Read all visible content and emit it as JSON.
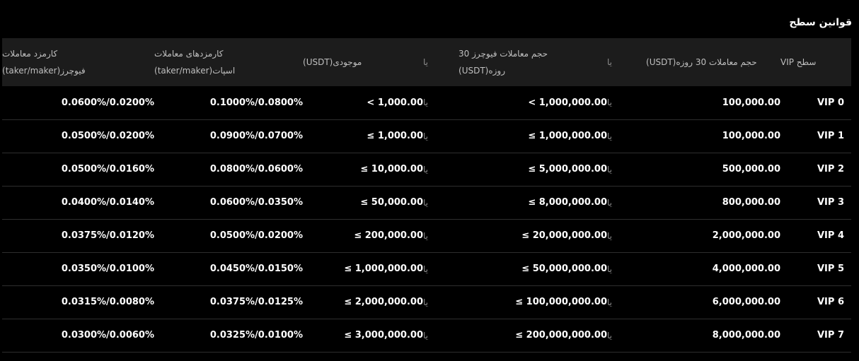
{
  "title": "قوانین سطح",
  "headers": {
    "level": "سطح VIP",
    "vol30": "حجم معاملات 30 روزه(USDT)",
    "or1": "یا",
    "fut_line1": "حجم معاملات فیوچرز 30",
    "fut_line2": "روزه(USDT)",
    "or2": "یا",
    "balance": "موجودی(USDT)",
    "spot_line1": "کارمزدهای معاملات",
    "spot_line2": "اسپات(taker/maker)",
    "fee_line1": "کارمزد معاملات",
    "fee_line2": "فیوچرز(taker/maker)"
  },
  "rows": [
    {
      "level": "VIP 0",
      "vol30": "100,000.00",
      "or1": "یا",
      "fut": "< 1,000,000.00",
      "or2": "یا",
      "balance": "< 1,000.00",
      "spot": "0.1000%/0.0800%",
      "fee": "0.0600%/0.0200%"
    },
    {
      "level": "VIP 1",
      "vol30": "100,000.00",
      "or1": "یا",
      "fut": "≤ 1,000,000.00",
      "or2": "یا",
      "balance": "≤ 1,000.00",
      "spot": "0.0900%/0.0700%",
      "fee": "0.0500%/0.0200%"
    },
    {
      "level": "VIP 2",
      "vol30": "500,000.00",
      "or1": "یا",
      "fut": "≤ 5,000,000.00",
      "or2": "یا",
      "balance": "≤ 10,000.00",
      "spot": "0.0800%/0.0600%",
      "fee": "0.0500%/0.0160%"
    },
    {
      "level": "VIP 3",
      "vol30": "800,000.00",
      "or1": "یا",
      "fut": "≤ 8,000,000.00",
      "or2": "یا",
      "balance": "≤ 50,000.00",
      "spot": "0.0600%/0.0350%",
      "fee": "0.0400%/0.0140%"
    },
    {
      "level": "VIP 4",
      "vol30": "2,000,000.00",
      "or1": "یا",
      "fut": "≤ 20,000,000.00",
      "or2": "یا",
      "balance": "≤ 200,000.00",
      "spot": "0.0500%/0.0200%",
      "fee": "0.0375%/0.0120%"
    },
    {
      "level": "VIP 5",
      "vol30": "4,000,000.00",
      "or1": "یا",
      "fut": "≤ 50,000,000.00",
      "or2": "یا",
      "balance": "≤ 1,000,000.00",
      "spot": "0.0450%/0.0150%",
      "fee": "0.0350%/0.0100%"
    },
    {
      "level": "VIP 6",
      "vol30": "6,000,000.00",
      "or1": "یا",
      "fut": "≤ 100,000,000.00",
      "or2": "یا",
      "balance": "≤ 2,000,000.00",
      "spot": "0.0375%/0.0125%",
      "fee": "0.0315%/0.0080%"
    },
    {
      "level": "VIP 7",
      "vol30": "8,000,000.00",
      "or1": "یا",
      "fut": "≤ 200,000,000.00",
      "or2": "یا",
      "balance": "≤ 3,000,000.00",
      "spot": "0.0325%/0.0100%",
      "fee": "0.0300%/0.0060%"
    }
  ]
}
